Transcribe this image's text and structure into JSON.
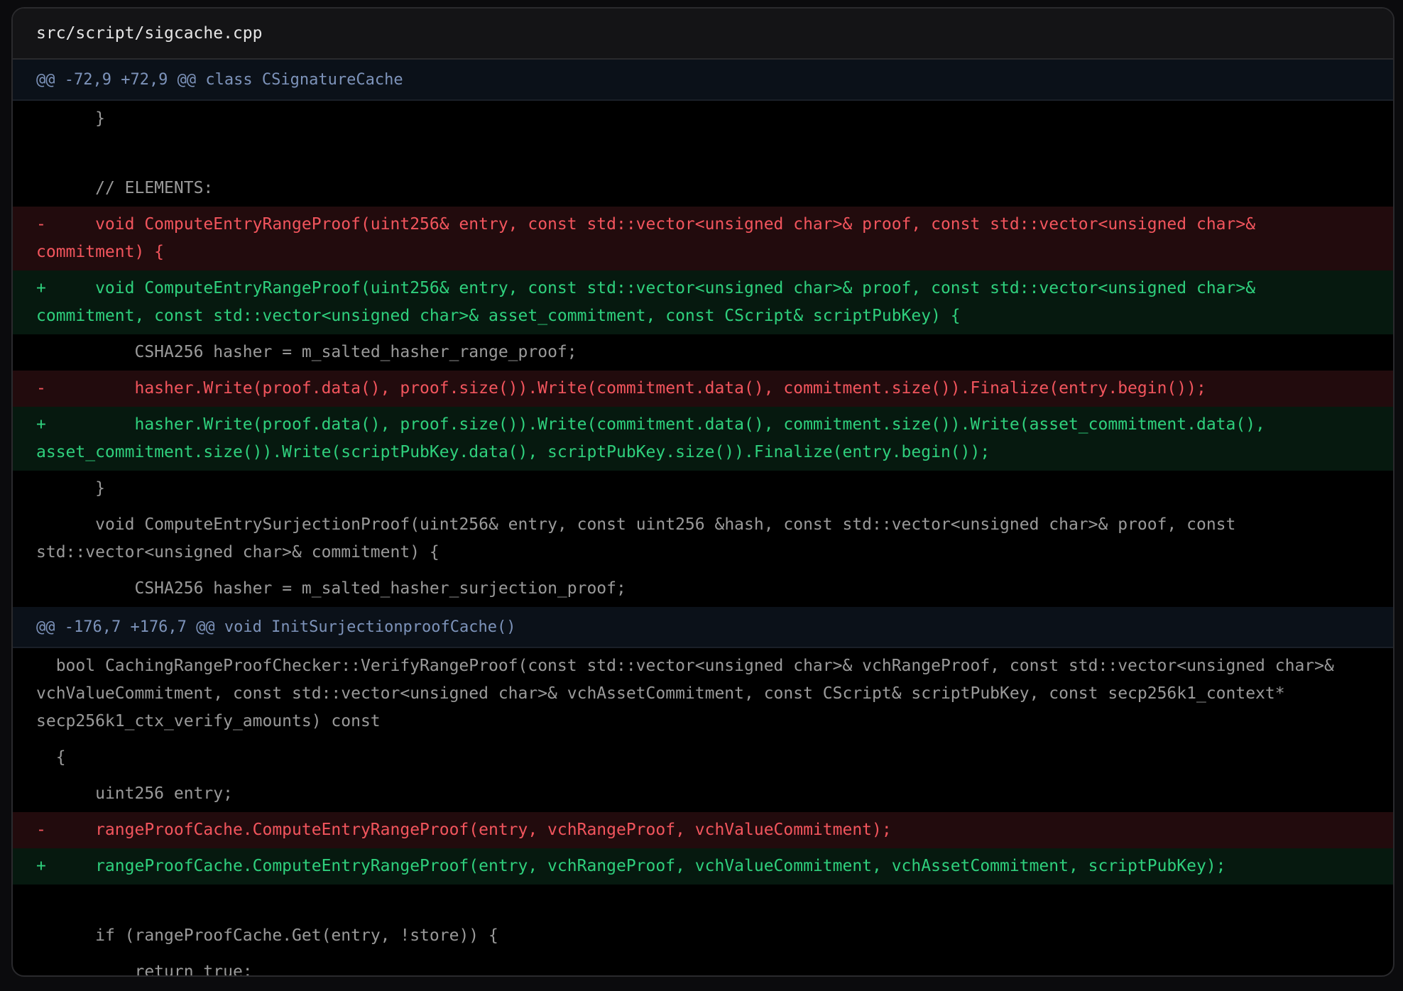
{
  "file": {
    "path": "src/script/sigcache.cpp"
  },
  "hunks": [
    {
      "header": "@@ -72,9 +72,9 @@ class CSignatureCache",
      "lines": [
        {
          "type": "ctx",
          "text": "      }"
        },
        {
          "type": "ctx",
          "text": ""
        },
        {
          "type": "ctx",
          "text": "      // ELEMENTS:"
        },
        {
          "type": "del",
          "text": "-     void ComputeEntryRangeProof(uint256& entry, const std::vector<unsigned char>& proof, const std::vector<unsigned char>& commitment) {"
        },
        {
          "type": "add",
          "text": "+     void ComputeEntryRangeProof(uint256& entry, const std::vector<unsigned char>& proof, const std::vector<unsigned char>& commitment, const std::vector<unsigned char>& asset_commitment, const CScript& scriptPubKey) {"
        },
        {
          "type": "ctx",
          "text": "          CSHA256 hasher = m_salted_hasher_range_proof;"
        },
        {
          "type": "del",
          "text": "-         hasher.Write(proof.data(), proof.size()).Write(commitment.data(), commitment.size()).Finalize(entry.begin());"
        },
        {
          "type": "add",
          "text": "+         hasher.Write(proof.data(), proof.size()).Write(commitment.data(), commitment.size()).Write(asset_commitment.data(), asset_commitment.size()).Write(scriptPubKey.data(), scriptPubKey.size()).Finalize(entry.begin());"
        },
        {
          "type": "ctx",
          "text": "      }"
        },
        {
          "type": "ctx",
          "text": "      void ComputeEntrySurjectionProof(uint256& entry, const uint256 &hash, const std::vector<unsigned char>& proof, const std::vector<unsigned char>& commitment) {"
        },
        {
          "type": "ctx",
          "text": "          CSHA256 hasher = m_salted_hasher_surjection_proof;"
        }
      ]
    },
    {
      "header": "@@ -176,7 +176,7 @@ void InitSurjectionproofCache()",
      "lines": [
        {
          "type": "ctx",
          "text": "  bool CachingRangeProofChecker::VerifyRangeProof(const std::vector<unsigned char>& vchRangeProof, const std::vector<unsigned char>& vchValueCommitment, const std::vector<unsigned char>& vchAssetCommitment, const CScript& scriptPubKey, const secp256k1_context* secp256k1_ctx_verify_amounts) const"
        },
        {
          "type": "ctx",
          "text": "  {"
        },
        {
          "type": "ctx",
          "text": "      uint256 entry;"
        },
        {
          "type": "del",
          "text": "-     rangeProofCache.ComputeEntryRangeProof(entry, vchRangeProof, vchValueCommitment);"
        },
        {
          "type": "add",
          "text": "+     rangeProofCache.ComputeEntryRangeProof(entry, vchRangeProof, vchValueCommitment, vchAssetCommitment, scriptPubKey);"
        },
        {
          "type": "ctx",
          "text": ""
        },
        {
          "type": "ctx",
          "text": "      if (rangeProofCache.Get(entry, !store)) {"
        },
        {
          "type": "ctx",
          "text": "          return true;"
        }
      ]
    }
  ]
}
